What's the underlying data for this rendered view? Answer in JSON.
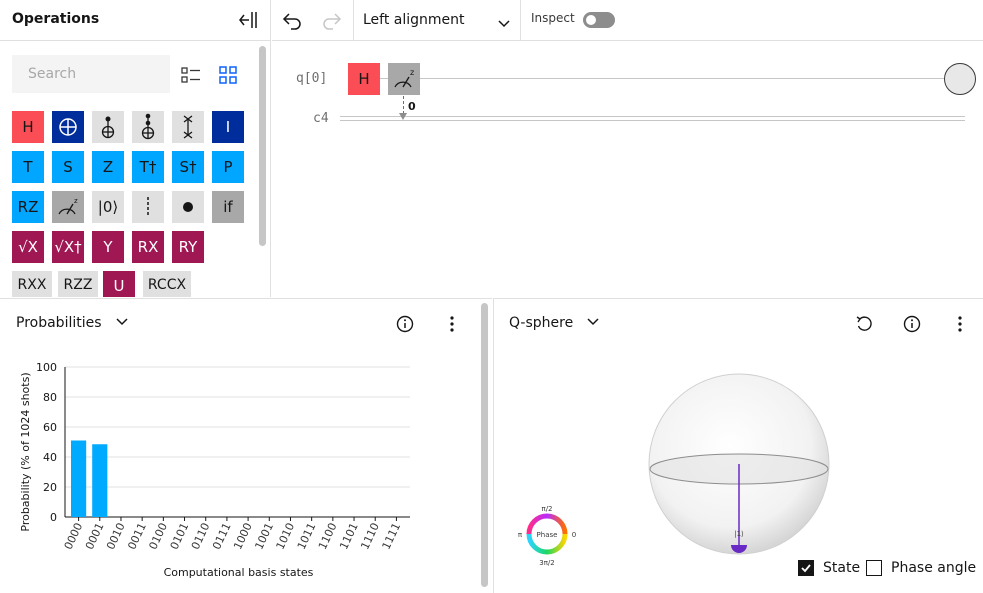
{
  "operations": {
    "title": "Operations",
    "search_placeholder": "Search",
    "gates": {
      "h": "H",
      "i": "I",
      "t": "T",
      "s": "S",
      "z": "Z",
      "tdg": "T†",
      "sdg": "S†",
      "p": "P",
      "rz": "RZ",
      "reset": "|0⟩",
      "if": "if",
      "sx": "√X",
      "sxdg": "√X†",
      "y": "Y",
      "rx": "RX",
      "ry": "RY",
      "rxx": "RXX",
      "rzz": "RZZ",
      "u": "U",
      "rccx": "RCCX"
    }
  },
  "toolbar": {
    "alignment": "Left alignment",
    "inspect_label": "Inspect",
    "inspect_on": false
  },
  "circuit": {
    "qubit_label": "q[0]",
    "classical_label": "c4",
    "gate_h": "H",
    "measure_bit": "0"
  },
  "probabilities": {
    "title": "Probabilities",
    "chart_data": {
      "type": "bar",
      "categories": [
        "0000",
        "0001",
        "0010",
        "0011",
        "0100",
        "0101",
        "0110",
        "0111",
        "1000",
        "1001",
        "1010",
        "1011",
        "1100",
        "1101",
        "1110",
        "1111"
      ],
      "values": [
        51,
        48.5,
        0,
        0,
        0,
        0,
        0,
        0,
        0,
        0,
        0,
        0,
        0,
        0,
        0,
        0
      ],
      "ylabel": "Probability (% of 1024 shots)",
      "xlabel": "Computational basis states",
      "ylim": [
        0,
        100
      ],
      "yticks": [
        0,
        20,
        40,
        60,
        80,
        100
      ],
      "grid": true,
      "bar_color": "#00aaff"
    }
  },
  "qsphere": {
    "title": "Q-sphere",
    "state_label": "|1⟩",
    "phase_label": "Phase",
    "phase_top": "π/2",
    "phase_left": "π",
    "phase_right": "0",
    "phase_bottom": "3π/2",
    "state_checkbox": "State",
    "state_checked": true,
    "phase_checkbox": "Phase angle",
    "phase_checked": false
  },
  "colors": {
    "accent": "#0f62fe",
    "h_gate": "#fa4d56",
    "bar": "#00aaff",
    "state_marker": "#6929c4"
  }
}
